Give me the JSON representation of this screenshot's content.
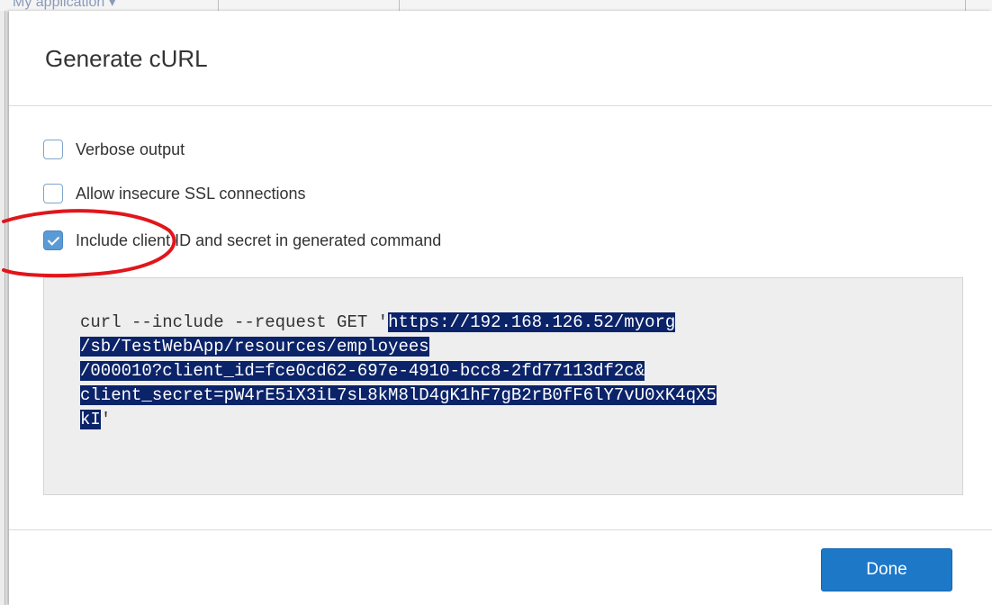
{
  "background_app": {
    "title": "My application ▾"
  },
  "dialog": {
    "title": "Generate cURL",
    "options": [
      {
        "label": "Verbose output",
        "checked": false
      },
      {
        "label": "Allow insecure SSL connections",
        "checked": false
      },
      {
        "label": "Include client ID and secret in generated command",
        "checked": true
      }
    ],
    "command": {
      "prefix": "curl --include --request GET '",
      "lines": [
        "https://192.168.126.52/myorg",
        "/sb/TestWebApp/resources/employees",
        "/000010?client_id=fce0cd62-697e-4910-bcc8-2fd77113df2c&",
        "client_secret=pW4rE5iX3iL7sL8kM8lD4gK1hF7gB2rB0fF6lY7vU0xK4qX5",
        "kI"
      ],
      "suffix": "'"
    },
    "done_label": "Done"
  },
  "colors": {
    "selection": "#0b2369",
    "primary_button": "#1e78c8",
    "annotation": "#e0161b"
  }
}
